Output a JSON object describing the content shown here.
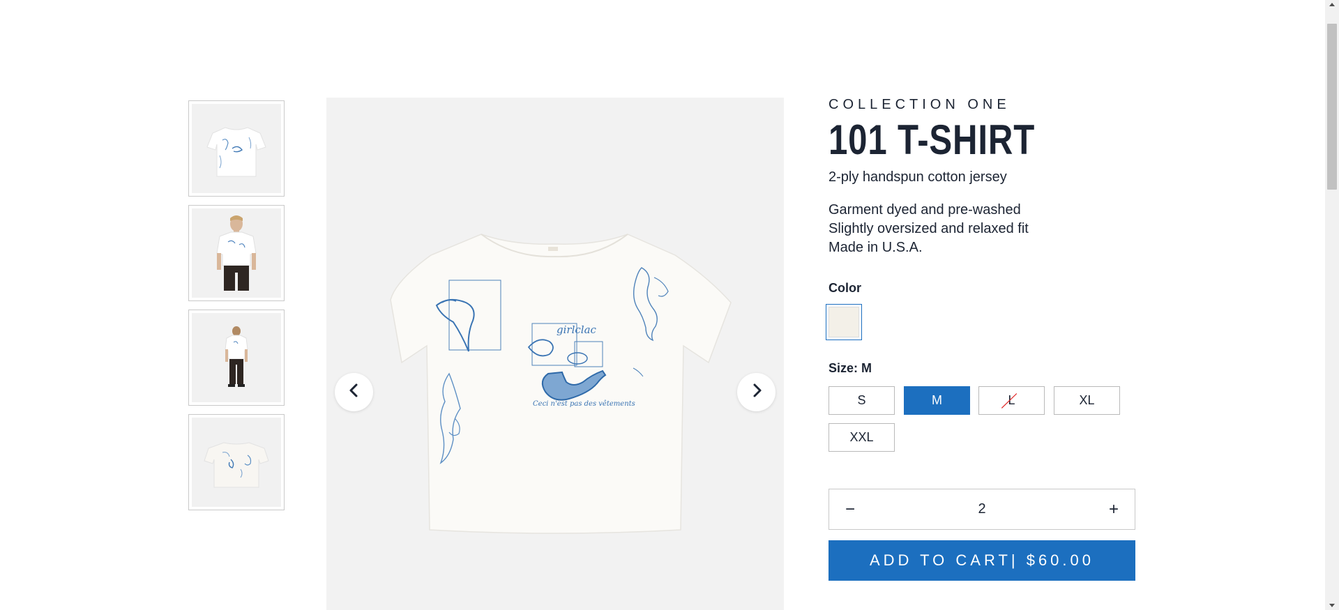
{
  "gallery": {
    "thumbnails": [
      {
        "alt": "t-shirt-flat-front"
      },
      {
        "alt": "model-front"
      },
      {
        "alt": "model-back"
      },
      {
        "alt": "t-shirt-flat-back"
      }
    ],
    "prev_icon": "chevron-left-icon",
    "next_icon": "chevron-right-icon",
    "print_text": "Ceci n'est pas des vêtements",
    "print_text_top": "girlclac"
  },
  "product": {
    "collection": "COLLECTION ONE",
    "title": "101 T-SHIRT",
    "subtitle": "2-ply handspun cotton jersey",
    "features": [
      "Garment dyed and pre-washed",
      "Slightly oversized and relaxed fit",
      "Made in U.S.A."
    ],
    "color_label": "Color",
    "color_swatch": "#f3f0e8",
    "size_label": "Size: M",
    "sizes": [
      {
        "label": "S",
        "selected": false,
        "available": true
      },
      {
        "label": "M",
        "selected": true,
        "available": true
      },
      {
        "label": "L",
        "selected": false,
        "available": false
      },
      {
        "label": "XL",
        "selected": false,
        "available": true
      },
      {
        "label": "XXL",
        "selected": false,
        "available": true
      }
    ],
    "quantity": {
      "minus": "−",
      "value": "2",
      "plus": "+"
    },
    "add_to_cart": "ADD TO CART| $60.00"
  },
  "colors": {
    "accent": "#1c6fbf",
    "text": "#1c2433",
    "image_bg": "#f2f2f2"
  }
}
